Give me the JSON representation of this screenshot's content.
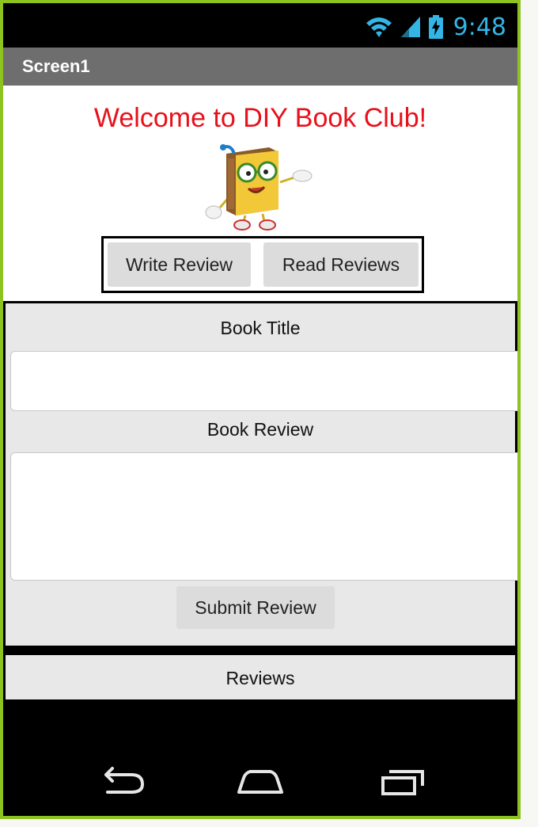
{
  "status_bar": {
    "time": "9:48",
    "icons": [
      "wifi-icon",
      "signal-icon",
      "battery-icon"
    ],
    "icon_color": "#33b5e5"
  },
  "title_bar": {
    "title": "Screen1"
  },
  "welcome": {
    "text": "Welcome to DIY Book Club!",
    "color": "#e8101a"
  },
  "mascot": {
    "icon": "book-mascot-icon"
  },
  "nav_buttons": {
    "write_review": "Write Review",
    "read_reviews": "Read Reviews"
  },
  "form": {
    "book_title_label": "Book Title",
    "book_title_value": "",
    "book_review_label": "Book Review",
    "book_review_value": "",
    "submit_label": "Submit Review"
  },
  "reviews": {
    "label": "Reviews"
  },
  "android_nav": {
    "icons": [
      "back-icon",
      "home-icon",
      "recent-apps-icon"
    ]
  },
  "colors": {
    "frame": "#8ec31f",
    "title_bar": "#6e6e6e",
    "panel": "#e8e8e8"
  }
}
